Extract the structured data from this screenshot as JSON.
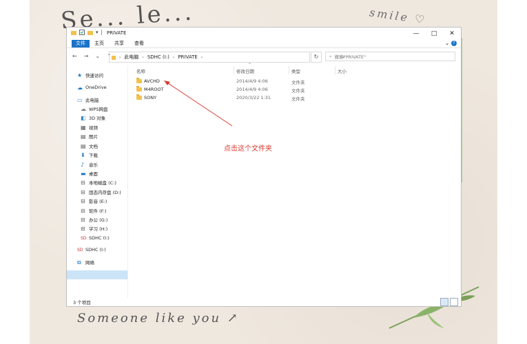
{
  "decor": {
    "top_text": "Se... le...",
    "smile_text": "smile ♡",
    "bottom_text": "Someone like you ↗"
  },
  "window": {
    "title": "PRIVATE",
    "controls": {
      "minimize": "—",
      "maximize": "□",
      "close": "✕"
    }
  },
  "ribbon": {
    "tabs": [
      "文件",
      "主页",
      "共享",
      "查看"
    ]
  },
  "addressbar": {
    "crumbs": [
      "此电脑",
      "SDHC (I:)",
      "PRIVATE"
    ],
    "search_placeholder": "搜索\"PRIVATE\""
  },
  "sidebar": {
    "items": [
      {
        "label": "快速访问",
        "icon": "star-icon"
      },
      {
        "label": "OneDrive",
        "icon": "cloud-icon"
      },
      {
        "label": "此电脑",
        "icon": "computer-icon"
      },
      {
        "label": "WPS网盘",
        "icon": "cloud-icon"
      },
      {
        "label": "3D 对象",
        "icon": "cube-icon"
      },
      {
        "label": "视频",
        "icon": "video-icon"
      },
      {
        "label": "图片",
        "icon": "picture-icon"
      },
      {
        "label": "文档",
        "icon": "document-icon"
      },
      {
        "label": "下载",
        "icon": "download-icon"
      },
      {
        "label": "音乐",
        "icon": "music-icon"
      },
      {
        "label": "桌面",
        "icon": "desktop-icon"
      },
      {
        "label": "本地磁盘 (C:)",
        "icon": "drive-icon"
      },
      {
        "label": "固态内存盘 (D:)",
        "icon": "drive-icon"
      },
      {
        "label": "影音 (E:)",
        "icon": "drive-icon"
      },
      {
        "label": "软件 (F:)",
        "icon": "drive-icon"
      },
      {
        "label": "办公 (G:)",
        "icon": "drive-icon"
      },
      {
        "label": "学习 (H:)",
        "icon": "drive-icon"
      },
      {
        "label": "SDHC (I:)",
        "icon": "sd-card-icon"
      },
      {
        "label": "SDHC (I:)",
        "icon": "sd-card-icon"
      },
      {
        "label": "网络",
        "icon": "network-icon"
      }
    ]
  },
  "files": {
    "columns": [
      "名称",
      "修改日期",
      "类型",
      "大小"
    ],
    "rows": [
      {
        "name": "AVCHD",
        "date": "2014/4/9 4:06",
        "type": "文件夹"
      },
      {
        "name": "M4ROOT",
        "date": "2014/4/9 4:06",
        "type": "文件夹"
      },
      {
        "name": "SONY",
        "date": "2020/3/22 1:31",
        "type": "文件夹"
      }
    ]
  },
  "annotation": {
    "text": "点击这个文件夹",
    "color": "#d63a2f"
  },
  "status": {
    "count": "3 个项目"
  },
  "colors": {
    "accent": "#1a73c8",
    "selection": "#cce4f7",
    "folder": "#f2c14e"
  }
}
